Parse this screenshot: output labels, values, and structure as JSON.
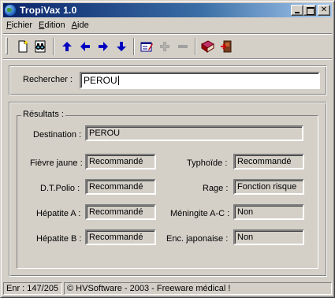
{
  "window": {
    "title": "TropiVax 1.0",
    "title_bar_color": "#0a246a"
  },
  "menu": [
    {
      "label": "Fichier",
      "accel": "F",
      "rest": "ichier"
    },
    {
      "label": "Edition",
      "accel": "E",
      "rest": "dition"
    },
    {
      "label": "Aide",
      "accel": "A",
      "rest": "ide"
    }
  ],
  "toolbar": {
    "buttons": [
      {
        "icon": "new-document-icon",
        "enabled": true
      },
      {
        "icon": "find-binoculars-icon",
        "enabled": true
      },
      {
        "icon": "arrow-up-icon",
        "enabled": true
      },
      {
        "icon": "arrow-left-icon",
        "enabled": true
      },
      {
        "icon": "arrow-right-icon",
        "enabled": true
      },
      {
        "icon": "arrow-down-icon",
        "enabled": true
      },
      {
        "icon": "edit-form-icon",
        "enabled": true
      },
      {
        "icon": "plus-icon",
        "enabled": false
      },
      {
        "icon": "minus-icon",
        "enabled": false
      },
      {
        "icon": "book-icon",
        "enabled": true
      },
      {
        "icon": "exit-door-icon",
        "enabled": true
      }
    ],
    "arrow_color": "#0000c0"
  },
  "search": {
    "label": "Rechercher :",
    "value": "PEROU"
  },
  "results": {
    "legend": "Résultats :",
    "destination_label": "Destination :",
    "destination_value": "PEROU",
    "fields": {
      "fievre_jaune": {
        "label": "Fièvre jaune :",
        "value": "Recommandé"
      },
      "typhoide": {
        "label": "Typhoïde :",
        "value": "Recommandé"
      },
      "dt_polio": {
        "label": "D.T.Polio :",
        "value": "Recommandé"
      },
      "rage": {
        "label": "Rage :",
        "value": "Fonction risque"
      },
      "hepatite_a": {
        "label": "Hépatite A :",
        "value": "Recommandé"
      },
      "meningite": {
        "label": "Méningite A-C :",
        "value": "Non"
      },
      "hepatite_b": {
        "label": "Hépatite B :",
        "value": "Recommandé"
      },
      "encephalite": {
        "label": "Enc. japonaise :",
        "value": "Non"
      }
    }
  },
  "statusbar": {
    "record": "Enr : 147/205",
    "copyright": "© HVSoftware - 2003 - Freeware médical !"
  }
}
